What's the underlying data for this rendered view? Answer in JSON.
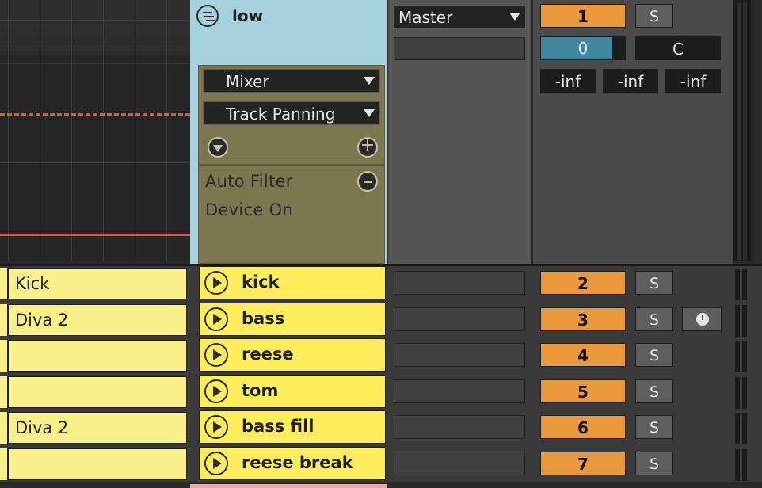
{
  "group": {
    "name": "low",
    "automation": {
      "device_dropdown": "Mixer",
      "param_dropdown": "Track Panning",
      "lane_device": "Auto Filter",
      "lane_param": "Device On"
    },
    "io": {
      "output": "Master"
    },
    "mixer": {
      "volume_label": "1",
      "solo": "S",
      "pan": "0",
      "crossfade": "C",
      "peaks": [
        "-inf",
        "-inf",
        "-inf"
      ]
    }
  },
  "tracks": [
    {
      "clip": "Kick",
      "name": "kick",
      "number": "2",
      "solo": "S"
    },
    {
      "clip": "Diva 2",
      "name": "bass",
      "number": "3",
      "solo": "S"
    },
    {
      "clip": "",
      "name": "reese",
      "number": "4",
      "solo": "S"
    },
    {
      "clip": "",
      "name": "tom",
      "number": "5",
      "solo": "S"
    },
    {
      "clip": "Diva 2",
      "name": "bass fill",
      "number": "6",
      "solo": "S"
    },
    {
      "clip": "",
      "name": "reese break",
      "number": "7",
      "solo": "S"
    }
  ],
  "colors": {
    "group": "#a6d2e0",
    "automation": "#7b7650",
    "track": "#ffed5c",
    "clip": "#faf08a",
    "volume": "#e9983c",
    "pan": "#3f86a0",
    "automation_line": "#d85a44"
  }
}
